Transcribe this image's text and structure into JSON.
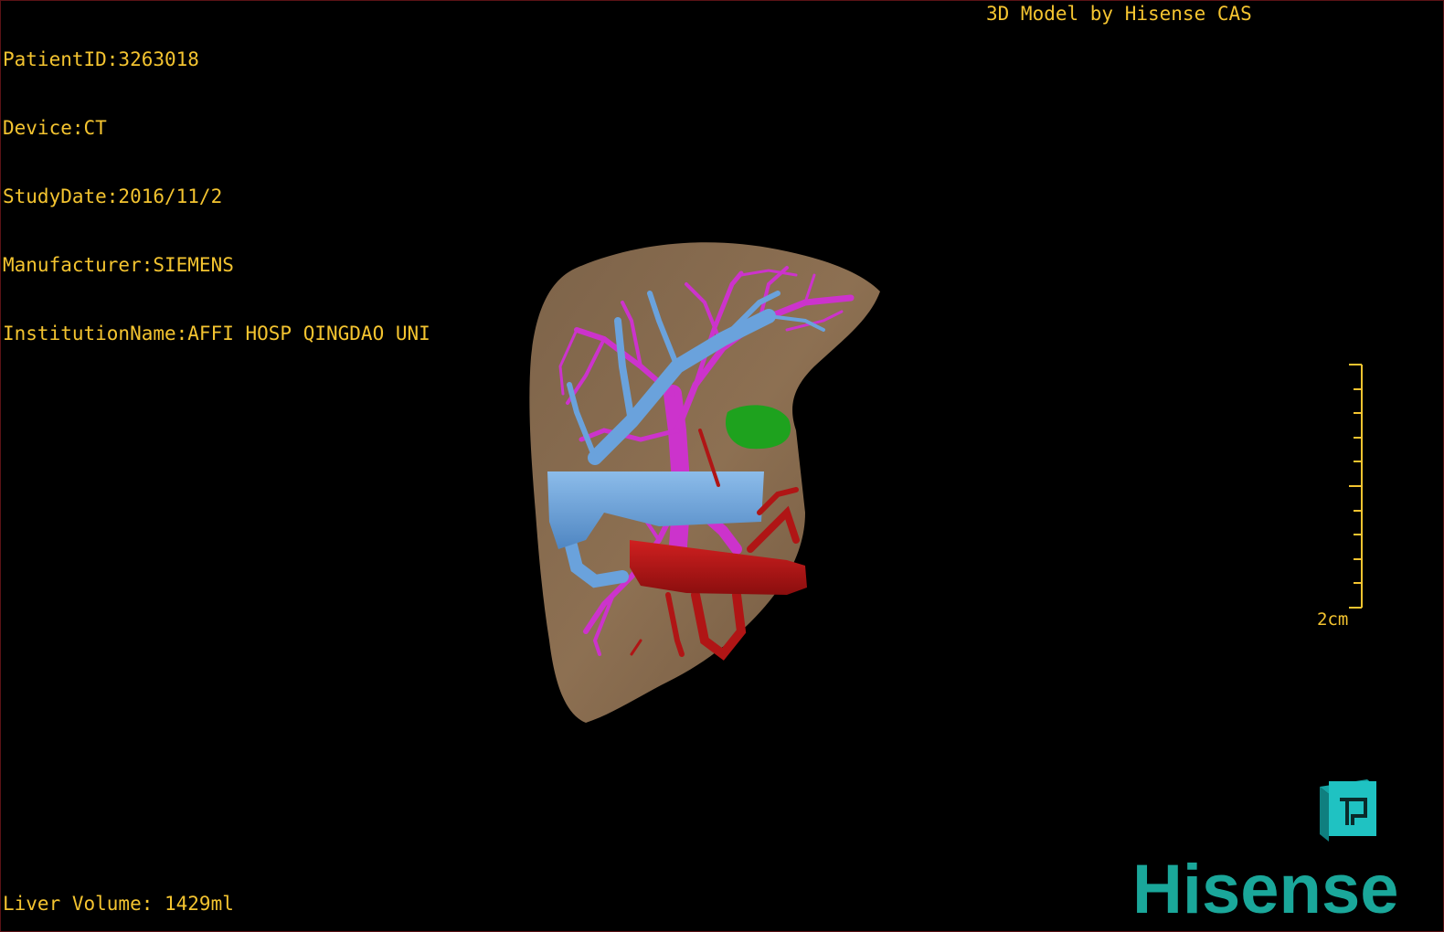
{
  "overlay": {
    "patient_id": "PatientID:3263018",
    "device": "Device:CT",
    "study_date": "StudyDate:2016/11/2",
    "manufacturer": "Manufacturer:SIEMENS",
    "institution": "InstitutionName:AFFI HOSP QINGDAO UNI",
    "model_credit": "3D Model by Hisense CAS",
    "liver_volume": "Liver Volume: 1429ml"
  },
  "scale_bar": {
    "label": "2cm"
  },
  "logo": {
    "text": "Hisense",
    "color": "#1aa79a"
  },
  "orientation_cube": {
    "icon": "orientation-cube-icon",
    "color": "#1fc2c2"
  },
  "colors": {
    "text": "#f4c430",
    "liver": "#8a6d4e",
    "hepatic_vein": "#6aa2dc",
    "portal_vein": "#cc33cc",
    "artery": "#b01515",
    "gallbladder": "#1ea21e"
  }
}
